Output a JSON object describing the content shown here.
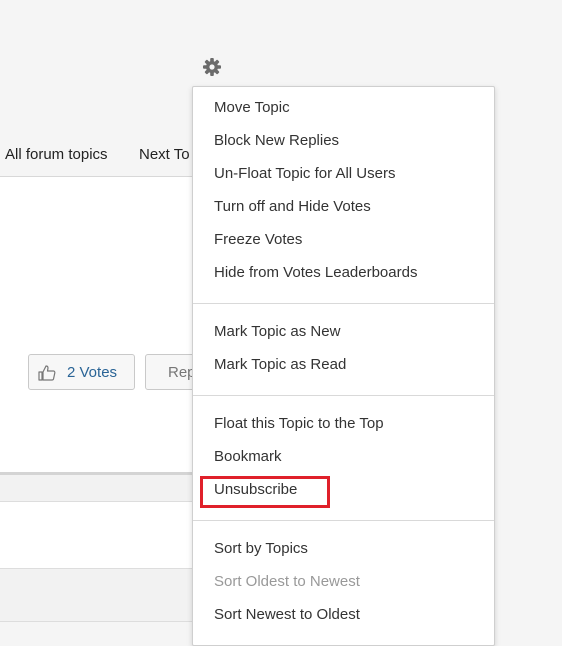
{
  "toolbar": {
    "settings_icon": "gear-icon"
  },
  "topic_nav": {
    "all_topics_label": "All forum topics",
    "next_topic_label": "Next To"
  },
  "votes": {
    "icon": "thumbs-up-icon",
    "label": "2 Votes"
  },
  "reply": {
    "label": "Rep"
  },
  "menu": {
    "groups": [
      {
        "items": [
          {
            "label": "Move Topic"
          },
          {
            "label": "Block New Replies"
          },
          {
            "label": "Un-Float Topic for All Users"
          },
          {
            "label": "Turn off and Hide Votes"
          },
          {
            "label": "Freeze Votes"
          },
          {
            "label": "Hide from Votes Leaderboards"
          }
        ]
      },
      {
        "items": [
          {
            "label": "Mark Topic as New"
          },
          {
            "label": "Mark Topic as Read"
          }
        ]
      },
      {
        "items": [
          {
            "label": "Float this Topic to the Top"
          },
          {
            "label": "Bookmark"
          },
          {
            "label": "Unsubscribe",
            "highlighted": true
          }
        ]
      },
      {
        "items": [
          {
            "label": "Sort by Topics"
          },
          {
            "label": "Sort Oldest to Newest",
            "disabled": true
          },
          {
            "label": "Sort Newest to Oldest"
          }
        ]
      }
    ]
  },
  "colors": {
    "highlight_border": "#e0202a",
    "link_blue": "#2a6496",
    "disabled_text": "#999999"
  }
}
